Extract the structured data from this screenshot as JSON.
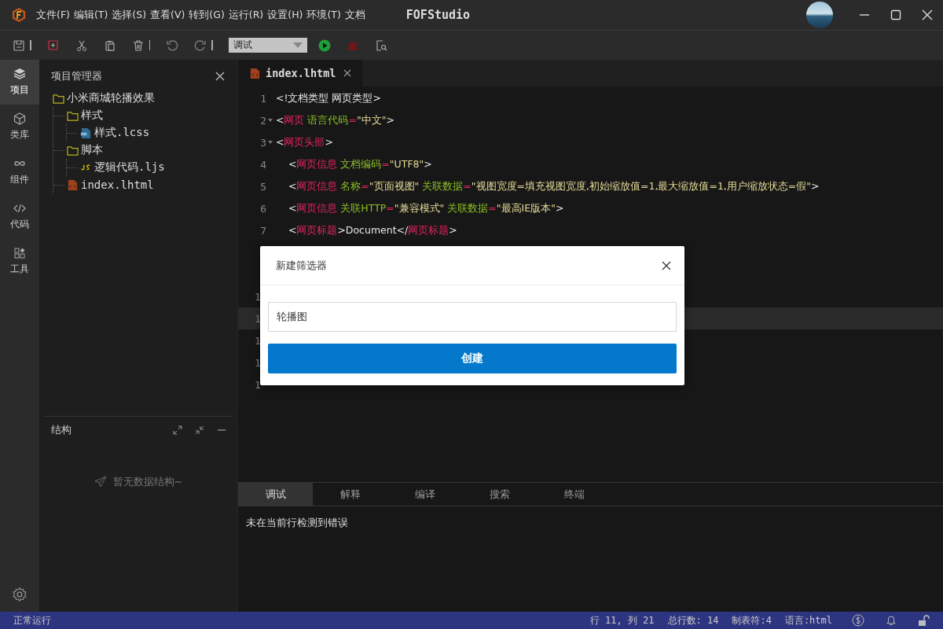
{
  "window": {
    "menu": [
      "文件(F)",
      "编辑(T)",
      "选择(S)",
      "查看(V)",
      "转到(G)",
      "运行(R)",
      "设置(H)",
      "环境(T)",
      "文档"
    ],
    "title": "FOFStudio"
  },
  "toolbar": {
    "mode_select": "调试"
  },
  "activity_bar": [
    {
      "label": "项目",
      "kind": "layers",
      "selected": true
    },
    {
      "label": "类库",
      "kind": "cube",
      "selected": false
    },
    {
      "label": "组件",
      "kind": "link",
      "selected": false
    },
    {
      "label": "代码",
      "kind": "code",
      "selected": false
    },
    {
      "label": "工具",
      "kind": "grid",
      "selected": false
    }
  ],
  "explorer": {
    "title": "项目管理器",
    "tree": [
      {
        "label": "小米商城轮播效果",
        "kind": "folder",
        "children": [
          {
            "label": "样式",
            "kind": "folder",
            "children": [
              {
                "label": "样式.lcss",
                "kind": "css"
              }
            ]
          },
          {
            "label": "脚本",
            "kind": "folder",
            "children": [
              {
                "label": "逻辑代码.ljs",
                "kind": "js"
              }
            ]
          },
          {
            "label": "index.lhtml",
            "kind": "html"
          }
        ]
      }
    ]
  },
  "structure": {
    "title": "结构",
    "empty_text": "暂无数据结构~"
  },
  "editor": {
    "tab": "index.lhtml",
    "lines": [
      {
        "kind": "code",
        "num": "1",
        "fold": false,
        "current": false,
        "tokens": [
          {
            "t": "<!文档类型 网页类型>",
            "kind": "text"
          }
        ]
      },
      {
        "kind": "code",
        "num": "2",
        "fold": true,
        "current": false,
        "tokens": [
          {
            "t": "<",
            "kind": "text"
          },
          {
            "t": "网页",
            "kind": "tag"
          },
          {
            "t": " 语言代码",
            "kind": "attr"
          },
          {
            "t": "=",
            "kind": "tag"
          },
          {
            "t": "\"中文\"",
            "kind": "str"
          },
          {
            "t": ">",
            "kind": "text"
          }
        ]
      },
      {
        "kind": "code",
        "num": "3",
        "fold": true,
        "current": false,
        "tokens": [
          {
            "t": "<",
            "kind": "text"
          },
          {
            "t": "网页头部",
            "kind": "tag"
          },
          {
            "t": ">",
            "kind": "text"
          }
        ]
      },
      {
        "kind": "code",
        "num": "4",
        "fold": false,
        "current": false,
        "tokens": [
          {
            "t": "    <",
            "kind": "text"
          },
          {
            "t": "网页信息",
            "kind": "tag"
          },
          {
            "t": " 文档编码",
            "kind": "attr"
          },
          {
            "t": "=",
            "kind": "tag"
          },
          {
            "t": "\"UTF8\"",
            "kind": "str"
          },
          {
            "t": ">",
            "kind": "text"
          }
        ]
      },
      {
        "kind": "code",
        "num": "5",
        "fold": false,
        "current": false,
        "tokens": [
          {
            "t": "    <",
            "kind": "text"
          },
          {
            "t": "网页信息",
            "kind": "tag"
          },
          {
            "t": " 名称",
            "kind": "attr"
          },
          {
            "t": "=",
            "kind": "tag"
          },
          {
            "t": "\"页面视图\"",
            "kind": "str"
          },
          {
            "t": " 关联数据",
            "kind": "attr"
          },
          {
            "t": "=",
            "kind": "tag"
          },
          {
            "t": "\"视图宽度=填充视图宽度,初始缩放值=1,最大缩放值=1,用户缩放状态=假\"",
            "kind": "str"
          },
          {
            "t": ">",
            "kind": "text"
          }
        ]
      },
      {
        "kind": "code",
        "num": "6",
        "fold": false,
        "current": false,
        "tokens": [
          {
            "t": "    <",
            "kind": "text"
          },
          {
            "t": "网页信息",
            "kind": "tag"
          },
          {
            "t": " 关联HTTP",
            "kind": "attr"
          },
          {
            "t": "=",
            "kind": "tag"
          },
          {
            "t": "\"兼容模式\"",
            "kind": "str"
          },
          {
            "t": " 关联数据",
            "kind": "attr"
          },
          {
            "t": "=",
            "kind": "tag"
          },
          {
            "t": "\"最高IE版本\"",
            "kind": "str"
          },
          {
            "t": ">",
            "kind": "text"
          }
        ]
      },
      {
        "kind": "code",
        "num": "7",
        "fold": false,
        "current": false,
        "tokens": [
          {
            "t": "    <",
            "kind": "text"
          },
          {
            "t": "网页标题",
            "kind": "tag"
          },
          {
            "t": ">Document</",
            "kind": "text"
          },
          {
            "t": "网页标题",
            "kind": "tag"
          },
          {
            "t": ">",
            "kind": "text"
          }
        ]
      },
      {
        "kind": "blank",
        "current": false
      },
      {
        "kind": "blank",
        "current": false
      },
      {
        "kind": "cut",
        "num": "1",
        "current": false
      },
      {
        "kind": "cut",
        "num": "1",
        "current": true
      },
      {
        "kind": "cut",
        "num": "1",
        "current": false
      },
      {
        "kind": "cut",
        "num": "1",
        "current": false
      },
      {
        "kind": "cut",
        "num": "1",
        "current": false
      }
    ]
  },
  "dialog": {
    "title": "新建筛选器",
    "input_value": "轮播图",
    "button": "创建"
  },
  "bottom_panel": {
    "tabs": [
      {
        "label": "调试",
        "selected": true
      },
      {
        "label": "解释",
        "selected": false
      },
      {
        "label": "编译",
        "selected": false
      },
      {
        "label": "搜索",
        "selected": false
      },
      {
        "label": "终端",
        "selected": false
      }
    ],
    "message": "未在当前行检测到错误"
  },
  "status_bar": {
    "left": "正常运行",
    "items": [
      "行 11, 列 21",
      "总行数: 14",
      "制表符:4",
      "语言:html"
    ]
  }
}
